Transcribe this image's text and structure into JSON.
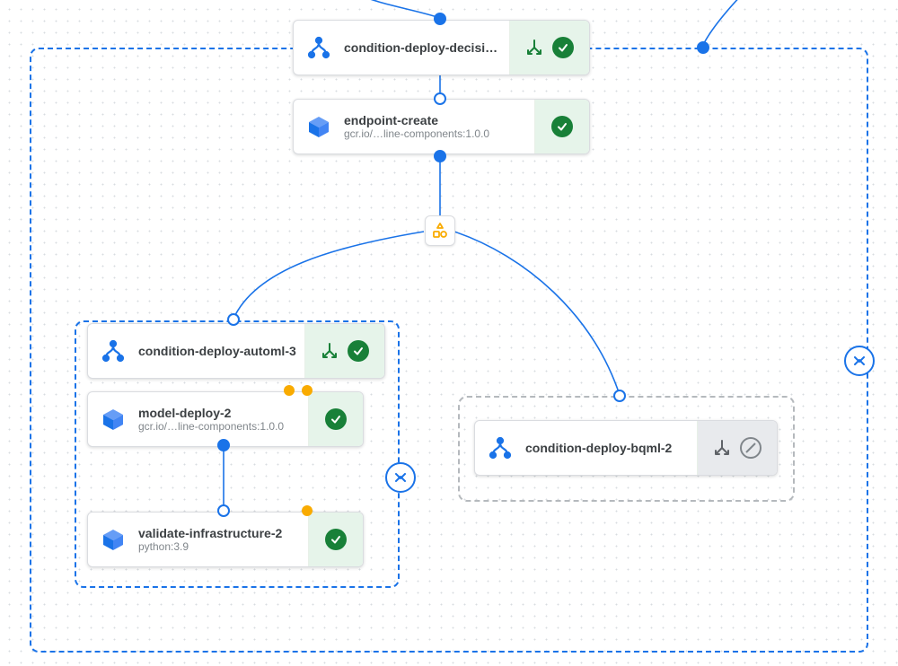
{
  "graph": {
    "nodes": {
      "decision": {
        "title": "condition-deploy-decisio…",
        "status": "success",
        "has_expand": true
      },
      "endpoint": {
        "title": "endpoint-create",
        "subtitle": "gcr.io/…line-components:1.0.0",
        "status": "success"
      },
      "automl": {
        "title": "condition-deploy-automl-3",
        "status": "success",
        "has_expand": true
      },
      "modeldeploy": {
        "title": "model-deploy-2",
        "subtitle": "gcr.io/…line-components:1.0.0",
        "status": "success"
      },
      "validate": {
        "title": "validate-infrastructure-2",
        "subtitle": "python:3.9",
        "status": "success"
      },
      "bqml": {
        "title": "condition-deploy-bqml-2",
        "status": "skipped",
        "has_expand": true
      }
    },
    "hub_icon": "shapes-icon",
    "colors": {
      "edge": "#1a73e8",
      "success_bg": "#e6f4ea",
      "success_fill": "#188038",
      "neutral_bg": "#e8eaed",
      "artifact": "#f9ab00"
    }
  }
}
